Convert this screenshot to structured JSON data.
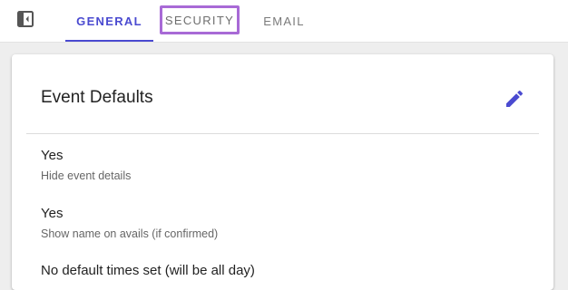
{
  "tabs": [
    {
      "label": "GENERAL"
    },
    {
      "label": "SECURITY"
    },
    {
      "label": "EMAIL"
    }
  ],
  "colors": {
    "accent": "#4a4ad0",
    "highlight_border": "#a86ad6"
  },
  "icons": {
    "toggle": "sidebar-collapse-icon",
    "edit": "pencil-icon"
  },
  "card": {
    "title": "Event Defaults",
    "settings": [
      {
        "value": "Yes",
        "description": "Hide event details"
      },
      {
        "value": "Yes",
        "description": "Show name on avails (if confirmed)"
      },
      {
        "value": "No default times set (will be all day)"
      }
    ]
  }
}
